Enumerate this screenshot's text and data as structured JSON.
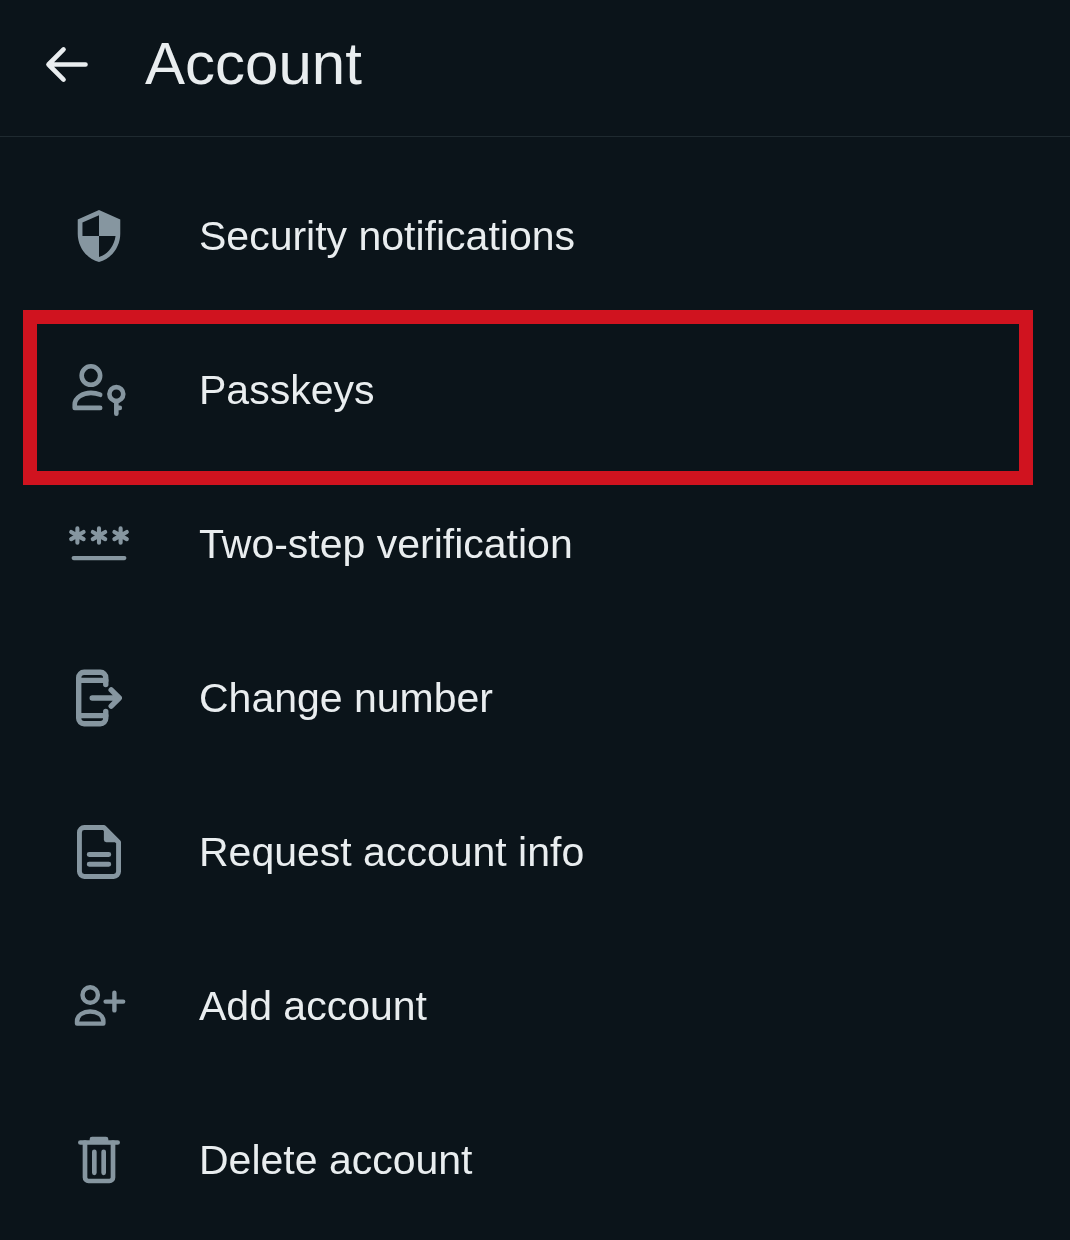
{
  "header": {
    "title": "Account"
  },
  "items": [
    {
      "kind": "shield",
      "label": "Security notifications",
      "highlighted": false
    },
    {
      "kind": "passkey",
      "label": "Passkeys",
      "highlighted": true
    },
    {
      "kind": "pin",
      "label": "Two-step verification",
      "highlighted": false
    },
    {
      "kind": "phone",
      "label": "Change number",
      "highlighted": false
    },
    {
      "kind": "document",
      "label": "Request account info",
      "highlighted": false
    },
    {
      "kind": "add_person",
      "label": "Add account",
      "highlighted": false
    },
    {
      "kind": "trash",
      "label": "Delete account",
      "highlighted": false
    }
  ]
}
